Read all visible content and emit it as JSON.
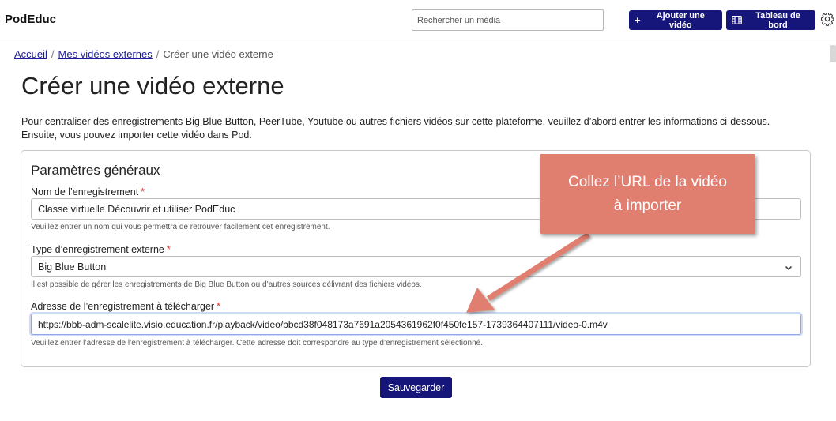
{
  "navbar": {
    "brand": "PodEduc",
    "search_placeholder": "Rechercher un média",
    "add_video_label": "Ajouter une vidéo",
    "dashboard_label": "Tableau de bord",
    "add_icon": "plus-icon",
    "dashboard_icon": "film-icon",
    "settings_icon": "gear-icon"
  },
  "breadcrumb": {
    "home": "Accueil",
    "external_videos": "Mes vidéos externes",
    "current": "Créer une vidéo externe"
  },
  "page": {
    "title": "Créer une vidéo externe",
    "intro_line1": "Pour centraliser des enregistrements Big Blue Button, PeerTube, Youtube ou autres fichiers vidéos sur cette plateforme, veuillez d’abord entrer les informations ci-dessous.",
    "intro_line2": "Ensuite, vous pouvez importer cette vidéo dans Pod."
  },
  "form": {
    "section_title": "Paramètres généraux",
    "required_mark": "*",
    "name": {
      "label": "Nom de l’enregistrement",
      "value": "Classe virtuelle Découvrir et utiliser PodEduc",
      "help": "Veuillez entrer un nom qui vous permettra de retrouver facilement cet enregistrement."
    },
    "type": {
      "label": "Type d’enregistrement externe",
      "value": "Big Blue Button",
      "help": "Il est possible de gérer les enregistrements de Big Blue Button ou d’autres sources délivrant des fichiers vidéos."
    },
    "url": {
      "label": "Adresse de l’enregistrement à télécharger",
      "value": "https://bbb-adm-scalelite.visio.education.fr/playback/video/bbcd38f048173a7691a2054361962f0f450fe157-1739364407111/video-0.m4v",
      "help": "Veuillez entrer l’adresse de l’enregistrement à télécharger. Cette adresse doit correspondre au type d’enregistrement sélectionné."
    },
    "submit_label": "Sauvegarder"
  },
  "callout": {
    "line1": "Collez l’URL de la vidéo",
    "line2": "à importer",
    "color": "#e07e6f"
  },
  "colors": {
    "primary": "#16167a",
    "required": "#d0312d",
    "link": "#1d1d9c"
  }
}
